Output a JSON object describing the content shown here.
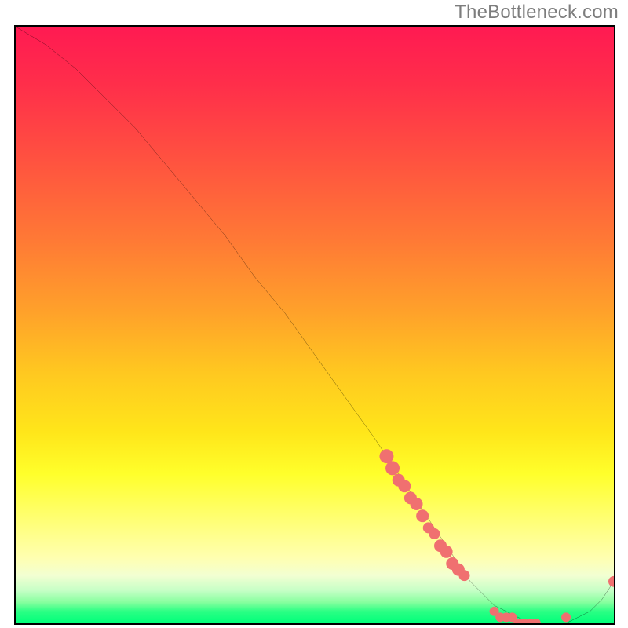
{
  "watermark": "TheBottleneck.com",
  "chart_data": {
    "type": "line",
    "title": "",
    "xlabel": "",
    "ylabel": "",
    "xlim": [
      0,
      100
    ],
    "ylim": [
      0,
      100
    ],
    "grid": false,
    "legend": false,
    "background_gradient": {
      "direction": "vertical",
      "stops": [
        {
          "pos": 0,
          "color": "#ff1a52"
        },
        {
          "pos": 22,
          "color": "#ff5140"
        },
        {
          "pos": 48,
          "color": "#ffa22a"
        },
        {
          "pos": 68,
          "color": "#ffe61a"
        },
        {
          "pos": 82,
          "color": "#ffff6e"
        },
        {
          "pos": 92,
          "color": "#f2ffd2"
        },
        {
          "pos": 96,
          "color": "#86ff9e"
        },
        {
          "pos": 100,
          "color": "#00ff7a"
        }
      ]
    },
    "series": [
      {
        "name": "bottleneck-curve",
        "color": "#000000",
        "x": [
          0,
          5,
          10,
          15,
          20,
          25,
          30,
          35,
          40,
          45,
          50,
          55,
          60,
          62,
          64,
          66,
          68,
          70,
          72,
          74,
          76,
          78,
          80,
          82,
          84,
          86,
          88,
          90,
          92,
          94,
          96,
          98,
          100
        ],
        "y": [
          100,
          97,
          93,
          88,
          83,
          77,
          71,
          65,
          58,
          52,
          45,
          38,
          31,
          28,
          25,
          22,
          19,
          16,
          13,
          10,
          7,
          5,
          3,
          2,
          1,
          0,
          0,
          0,
          0,
          1,
          2,
          4,
          7
        ]
      }
    ],
    "markers": [
      {
        "name": "highlight-dots",
        "color": "#f07070",
        "radius_px": 8,
        "points": [
          {
            "x": 62,
            "y": 28,
            "r": 9
          },
          {
            "x": 63,
            "y": 26,
            "r": 9
          },
          {
            "x": 64,
            "y": 24,
            "r": 8
          },
          {
            "x": 65,
            "y": 23,
            "r": 8
          },
          {
            "x": 66,
            "y": 21,
            "r": 8
          },
          {
            "x": 67,
            "y": 20,
            "r": 8
          },
          {
            "x": 68,
            "y": 18,
            "r": 8
          },
          {
            "x": 69,
            "y": 16,
            "r": 7
          },
          {
            "x": 70,
            "y": 15,
            "r": 7
          },
          {
            "x": 71,
            "y": 13,
            "r": 8
          },
          {
            "x": 72,
            "y": 12,
            "r": 8
          },
          {
            "x": 73,
            "y": 10,
            "r": 8
          },
          {
            "x": 74,
            "y": 9,
            "r": 8
          },
          {
            "x": 75,
            "y": 8,
            "r": 7
          },
          {
            "x": 80,
            "y": 2,
            "r": 6
          },
          {
            "x": 81,
            "y": 1,
            "r": 6
          },
          {
            "x": 82,
            "y": 1,
            "r": 6
          },
          {
            "x": 83,
            "y": 1,
            "r": 6
          },
          {
            "x": 84,
            "y": 0,
            "r": 6
          },
          {
            "x": 85,
            "y": 0,
            "r": 6
          },
          {
            "x": 86,
            "y": 0,
            "r": 6
          },
          {
            "x": 87,
            "y": 0,
            "r": 6
          },
          {
            "x": 92,
            "y": 1,
            "r": 6
          },
          {
            "x": 100,
            "y": 7,
            "r": 7
          }
        ]
      }
    ]
  }
}
